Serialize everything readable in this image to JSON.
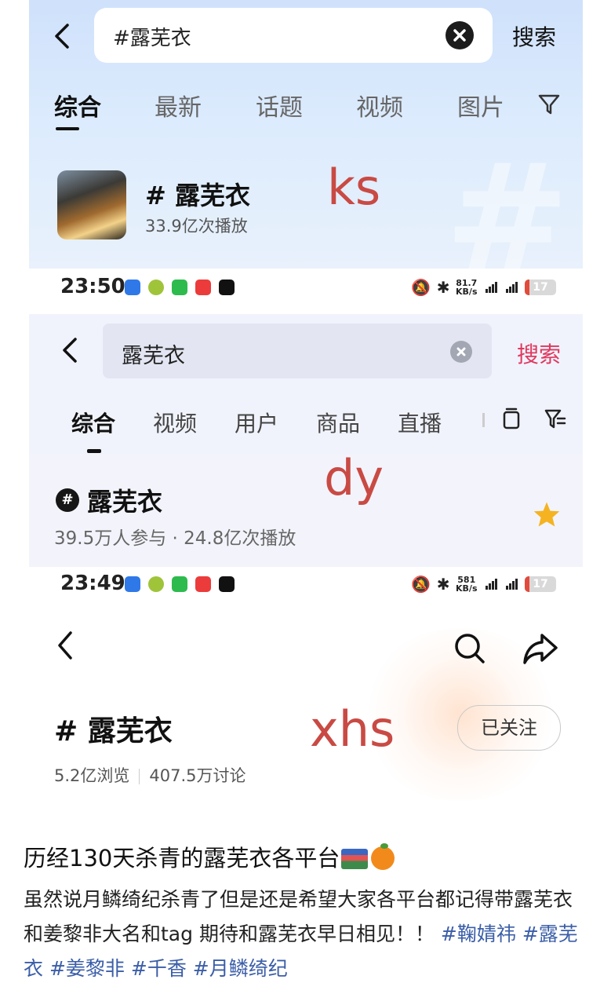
{
  "ks": {
    "search_query": "#露芜衣",
    "search_button": "搜索",
    "tabs": [
      "综合",
      "最新",
      "话题",
      "视频",
      "图片"
    ],
    "result_title": "# 露芜衣",
    "result_stats": "33.9亿次播放",
    "platform_tag": "ks"
  },
  "status1": {
    "time": "23:50",
    "net_speed": "81.7",
    "net_unit": "KB/s",
    "battery": "17"
  },
  "dy": {
    "search_query": "露芜衣",
    "search_button": "搜索",
    "tabs": [
      "综合",
      "视频",
      "用户",
      "商品",
      "直播"
    ],
    "result_title": "露芜衣",
    "result_stats": "39.5万人参与 · 24.8亿次播放",
    "platform_tag": "dy"
  },
  "status2": {
    "time": "23:49",
    "net_speed": "581",
    "net_unit": "KB/s",
    "battery": "17"
  },
  "xhs": {
    "topic_title": "# 露芜衣",
    "views": "5.2亿浏览",
    "discussions": "407.5万讨论",
    "follow_button": "已关注",
    "platform_tag": "xhs"
  },
  "post": {
    "title": "历经130天杀青的露芜衣各平台",
    "body": "虽然说月鳞绮纪杀青了但是还是希望大家各平台都记得带露芜衣和姜黎非大名和tag 期待和露芜衣早日相见！！",
    "hashtags": [
      "#鞠婧祎",
      "#露芜衣",
      "#姜黎非",
      "#千香",
      "#月鳞绮纪"
    ]
  },
  "colors": {
    "tag_red": "#c94a44",
    "dy_accent": "#e0385e",
    "hashtag_blue": "#3b5ea8",
    "star": "#f5b321"
  },
  "icons": [
    "back-icon",
    "clear-icon",
    "filter-icon",
    "search-icon",
    "share-icon",
    "star-icon"
  ]
}
